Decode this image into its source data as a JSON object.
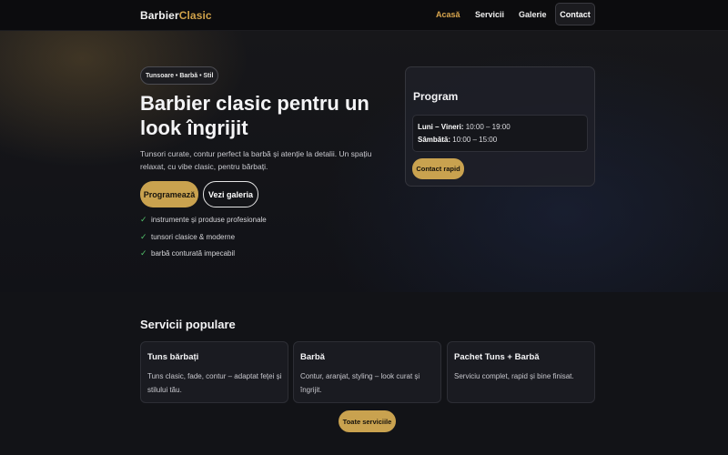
{
  "nav": {
    "brand_main": "Barbier",
    "brand_accent": "Clasic",
    "links": [
      {
        "label": "Acasă",
        "active": true
      },
      {
        "label": "Servicii",
        "active": false
      },
      {
        "label": "Galerie",
        "active": false
      }
    ],
    "contact_label": "Contact"
  },
  "hero": {
    "pill": "Tunsoare • Barbă • Stil",
    "title": "Barbier clasic pentru un look îngrijit",
    "description": "Tunsori curate, contur perfect la barbă și atenție la detalii. Un spațiu relaxat, cu vibe clasic, pentru bărbați.",
    "primary_button": "Programează",
    "secondary_button": "Vezi galeria",
    "features": [
      "instrumente și produse profesionale",
      "tunsori clasice & moderne",
      "barbă conturată impecabil"
    ]
  },
  "program": {
    "title": "Program",
    "hours": [
      {
        "days": "Luni – Vineri:",
        "time": "10:00 – 19:00"
      },
      {
        "days": "Sâmbătă:",
        "time": "10:00 – 15:00"
      }
    ],
    "button": "Contact rapid"
  },
  "services": {
    "title": "Servicii populare",
    "items": [
      {
        "name": "Tuns bărbați",
        "desc": "Tuns clasic, fade, contur – adaptat feței și stilului tău."
      },
      {
        "name": "Barbă",
        "desc": "Contur, aranjat, styling – look curat și îngrijit."
      },
      {
        "name": "Pachet Tuns + Barbă",
        "desc": "Serviciu complet, rapid și bine finisat."
      }
    ],
    "all_button": "Toate serviciile"
  },
  "colors": {
    "accent": "#c9a24f",
    "background": "#121317",
    "check": "#52c06b"
  }
}
